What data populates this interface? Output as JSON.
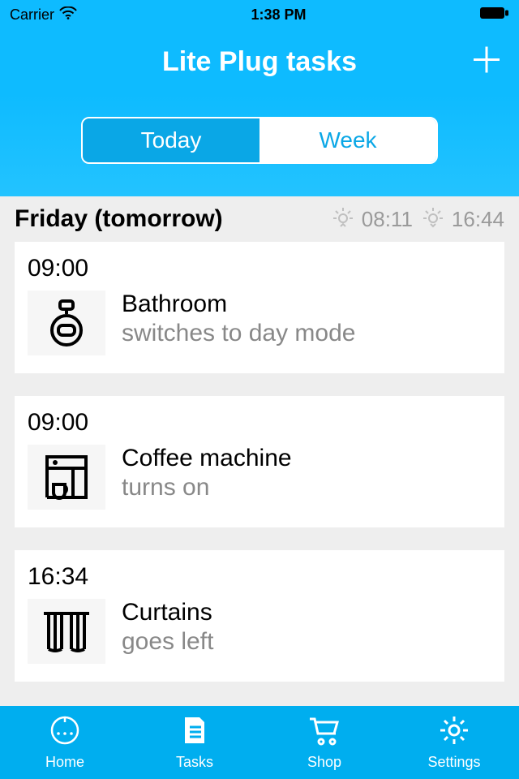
{
  "status": {
    "carrier": "Carrier",
    "time": "1:38 PM"
  },
  "header": {
    "title": "Lite Plug tasks"
  },
  "segments": {
    "today": "Today",
    "week": "Week",
    "active": "today"
  },
  "day": {
    "title": "Friday (tomorrow)",
    "sunrise": "08:11",
    "sunset": "16:44"
  },
  "tasks": [
    {
      "time": "09:00",
      "name": "Bathroom",
      "action": "switches to day mode",
      "icon": "bottle"
    },
    {
      "time": "09:00",
      "name": "Coffee machine",
      "action": "turns on",
      "icon": "coffee"
    },
    {
      "time": "16:34",
      "name": "Curtains",
      "action": "goes left",
      "icon": "curtains"
    }
  ],
  "tabs": {
    "home": "Home",
    "tasks": "Tasks",
    "shop": "Shop",
    "settings": "Settings"
  }
}
